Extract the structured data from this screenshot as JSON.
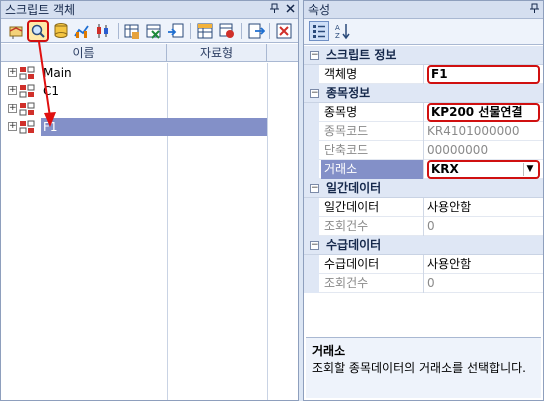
{
  "left_panel": {
    "title": "스크립트 객체",
    "pin_label": "ᆊ",
    "close_label": "×",
    "columns": [
      "이름",
      "자료형"
    ],
    "tree": [
      {
        "label": "Main",
        "selected": false
      },
      {
        "label": "C1",
        "selected": false
      },
      {
        "label": "",
        "selected": false
      },
      {
        "label": "F1",
        "selected": true
      }
    ],
    "toolbar_icons": [
      "new-script-icon",
      "search-icon",
      "database-icon",
      "chart-icon",
      "candle-icon",
      "grid-add-icon",
      "excel-icon",
      "import-icon",
      "table-edit-icon",
      "table-copy-icon",
      "export-icon",
      "delete-icon"
    ],
    "expander_symbol": "+"
  },
  "right_panel": {
    "title": "속성",
    "pin_label": "ᆊ",
    "toolbar_icons": [
      "categorized-icon",
      "alphabetical-icon"
    ],
    "categories": [
      {
        "label": "스크립트 정보",
        "toggle": "−",
        "props": [
          {
            "name": "객체명",
            "value": "F1",
            "boxed": true,
            "disabled": false
          }
        ]
      },
      {
        "label": "종목정보",
        "toggle": "−",
        "props": [
          {
            "name": "종목명",
            "value": "KP200 선물연결",
            "boxed": true,
            "disabled": false
          },
          {
            "name": "종목코드",
            "value": "KR4101000000",
            "boxed": false,
            "disabled": true
          },
          {
            "name": "단축코드",
            "value": "00000000",
            "boxed": false,
            "disabled": true
          },
          {
            "name": "거래소",
            "value": "KRX",
            "boxed": true,
            "disabled": false,
            "selected": true,
            "dropdown": true
          }
        ]
      },
      {
        "label": "일간데이터",
        "toggle": "−",
        "props": [
          {
            "name": "일간데이터",
            "value": "사용안함",
            "boxed": false,
            "disabled": false
          },
          {
            "name": "조회건수",
            "value": "0",
            "boxed": false,
            "disabled": true
          }
        ]
      },
      {
        "label": "수급데이터",
        "toggle": "−",
        "props": [
          {
            "name": "수급데이터",
            "value": "사용안함",
            "boxed": false,
            "disabled": false
          },
          {
            "name": "조회건수",
            "value": "0",
            "boxed": false,
            "disabled": true
          }
        ]
      }
    ],
    "description": {
      "title": "거래소",
      "text": "조회할 종목데이터의 거래소를 선택합니다."
    },
    "dropdown_symbol": "▼"
  },
  "colors": {
    "selection": "#8390c8",
    "highlight_border": "#d01010",
    "arrow": "#e01010"
  }
}
